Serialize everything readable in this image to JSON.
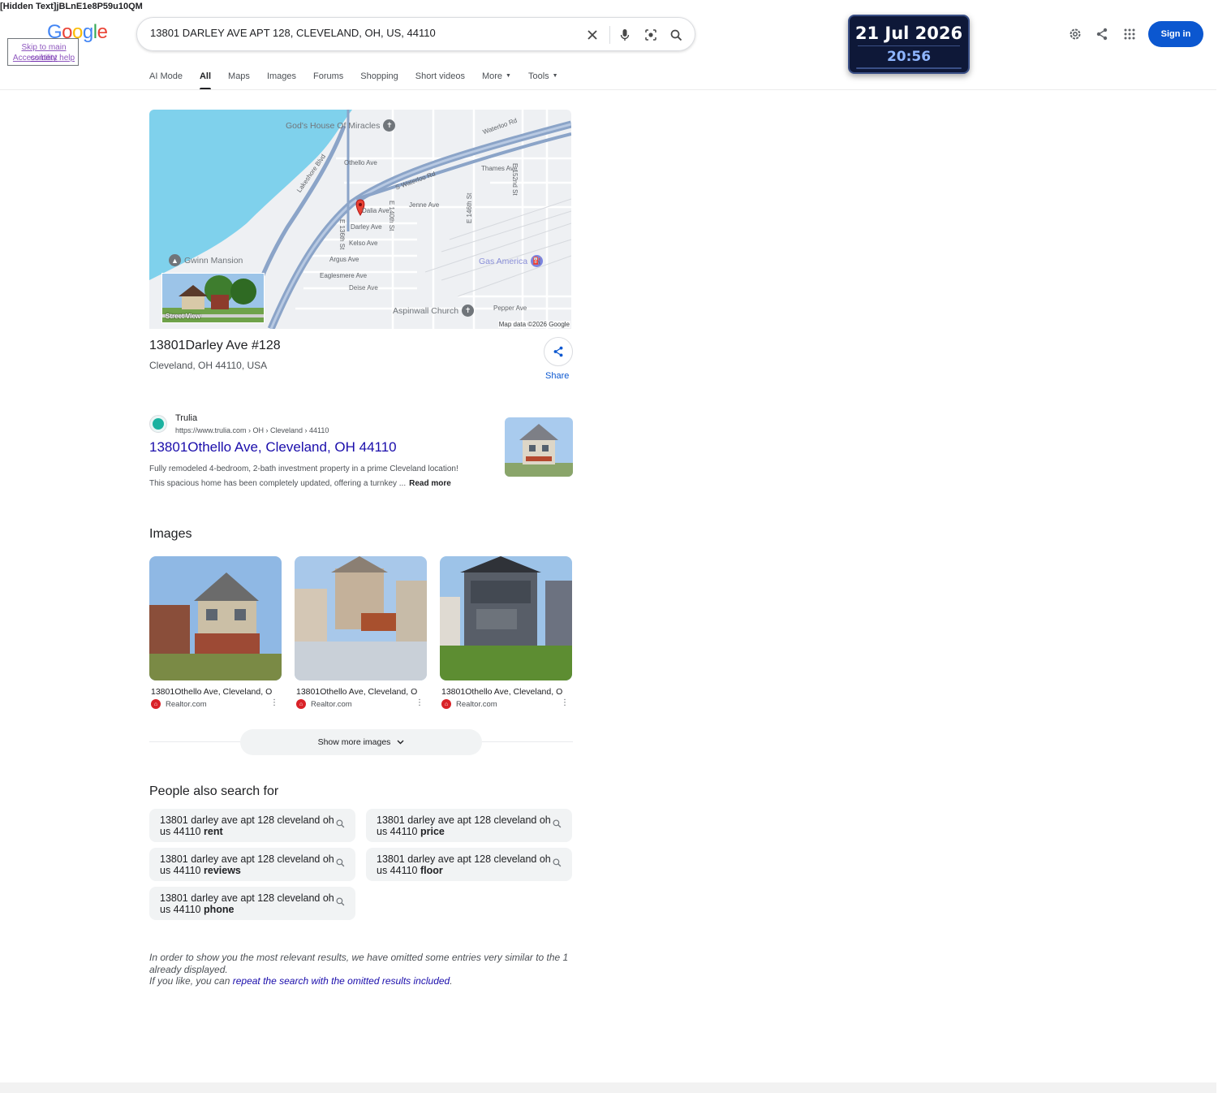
{
  "corner_text": "[Hidden Text]jBLnE1e8P59u10QM",
  "skip_links": [
    "Skip to main content",
    "Accessibility help"
  ],
  "logo": {
    "letters": [
      "G",
      "o",
      "o",
      "g",
      "l",
      "e"
    ]
  },
  "search": {
    "query": "13801 DARLEY AVE APT 128, CLEVELAND, OH, US, 44110"
  },
  "datetime": {
    "date": "21 Jul 2026",
    "time": "20:56"
  },
  "header": {
    "sign_in": "Sign in"
  },
  "tabs": [
    {
      "label": "AI Mode"
    },
    {
      "label": "All",
      "active": true
    },
    {
      "label": "Maps"
    },
    {
      "label": "Images"
    },
    {
      "label": "Forums"
    },
    {
      "label": "Shopping"
    },
    {
      "label": "Short videos"
    },
    {
      "label": "More"
    },
    {
      "label": "Tools"
    }
  ],
  "map": {
    "streets": [
      "Waterloo Rd",
      "S Waterloo Rd",
      "Lakeshore Blvd",
      "Othello Ave",
      "Thames Ave",
      "E 152nd St",
      "Jenne Ave",
      "E 146th St",
      "E 140th St",
      "Darley Ave",
      "Dalia Ave",
      "E 136th St",
      "Kelso Ave",
      "Argus Ave",
      "Eaglesmere Ave",
      "Deise Ave",
      "Pepper Ave"
    ],
    "poi": [
      "God's House Of Miracles",
      "Gwinn Mansion",
      "Gas America",
      "Aspinwall Church"
    ],
    "street_view_label": "Street View",
    "credit": "Map data ©2026 Google"
  },
  "place": {
    "name": "13801Darley Ave #128",
    "address": "Cleveland, OH 44110, USA",
    "share_label": "Share"
  },
  "result": {
    "site": "Trulia",
    "url": "https://www.trulia.com › OH › Cleveland › 44110",
    "title": "13801Othello Ave, Cleveland, OH 44110",
    "snippet": "Fully remodeled 4-bedroom, 2-bath investment property in a prime Cleveland location! This spacious home has been completely updated, offering a turnkey ...",
    "read_more": "Read more"
  },
  "images_section": {
    "heading": "Images",
    "cards": [
      {
        "caption": "13801Othello Ave, Cleveland, O",
        "source": "Realtor.com"
      },
      {
        "caption": "13801Othello Ave, Cleveland, O",
        "source": "Realtor.com"
      },
      {
        "caption": "13801Othello Ave, Cleveland, O",
        "source": "Realtor.com"
      }
    ],
    "show_more": "Show more images"
  },
  "people_also_search": {
    "heading": "People also search for",
    "items": [
      {
        "base": "13801 darley ave apt 128 cleveland oh us 44110",
        "bold": "rent"
      },
      {
        "base": "13801 darley ave apt 128 cleveland oh us 44110",
        "bold": "price"
      },
      {
        "base": "13801 darley ave apt 128 cleveland oh us 44110",
        "bold": "reviews"
      },
      {
        "base": "13801 darley ave apt 128 cleveland oh us 44110",
        "bold": "floor"
      },
      {
        "base": "13801 darley ave apt 128 cleveland oh us 44110",
        "bold": "phone"
      }
    ]
  },
  "omitted": {
    "line1": "In order to show you the most relevant results, we have omitted some entries very similar to the 1 already displayed.",
    "prefix": "If you like, you can",
    "link": "repeat the search with the omitted results included",
    "suffix": "."
  }
}
